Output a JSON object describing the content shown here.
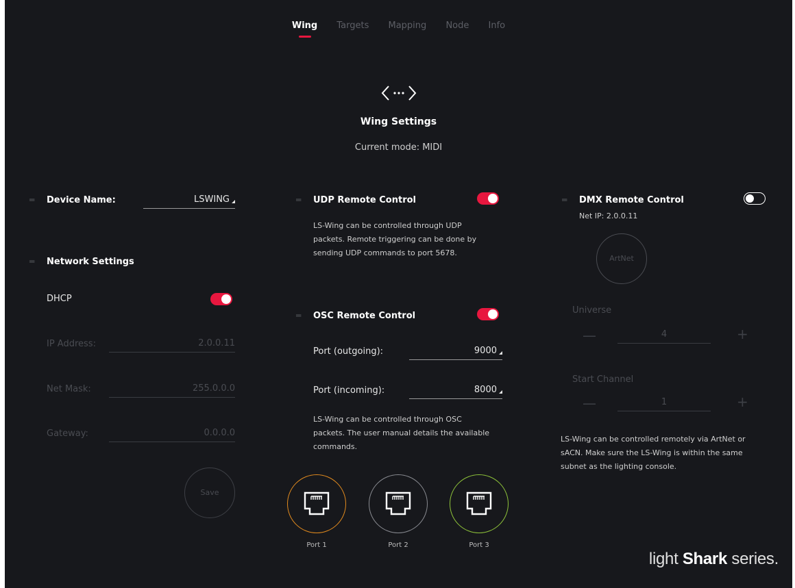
{
  "tabs": [
    "Wing",
    "Targets",
    "Mapping",
    "Node",
    "Info"
  ],
  "header": {
    "title": "Wing Settings",
    "mode": "Current mode: MIDI"
  },
  "device": {
    "label": "Device Name:",
    "value": "LSWING"
  },
  "network": {
    "title": "Network Settings",
    "dhcp_label": "DHCP",
    "dhcp_on": true,
    "ip_label": "IP Address:",
    "ip_value": "2.0.0.11",
    "mask_label": "Net Mask:",
    "mask_value": "255.0.0.0",
    "gateway_label": "Gateway:",
    "gateway_value": "0.0.0.0",
    "save_label": "Save"
  },
  "udp": {
    "title": "UDP Remote Control",
    "enabled": true,
    "desc": [
      "LS-Wing can be controlled through UDP",
      "packets. Remote triggering can be done by",
      "sending UDP commands to port 5678."
    ]
  },
  "osc": {
    "title": "OSC Remote Control",
    "enabled": true,
    "out_label": "Port (outgoing):",
    "out_value": "9000",
    "in_label": "Port (incoming):",
    "in_value": "8000",
    "desc": [
      "LS-Wing can be controlled through OSC",
      "packets. The user manual details the available",
      "commands."
    ]
  },
  "ports": [
    {
      "label": "Port 1",
      "color": "#e38b1e"
    },
    {
      "label": "Port 2",
      "color": "#8a8c92"
    },
    {
      "label": "Port 3",
      "color": "#8fc43a"
    }
  ],
  "dmx": {
    "title": "DMX Remote Control",
    "enabled": false,
    "net_ip": "Net IP: 2.0.0.11",
    "protocol_button": "ArtNet",
    "universe_label": "Universe",
    "universe_value": "4",
    "start_label": "Start Channel",
    "start_value": "1",
    "minus": "—",
    "plus": "+",
    "desc": [
      "LS-Wing can be controlled remotely via ArtNet or",
      "sACN. Make sure the LS-Wing is within the same",
      "subnet as the lighting console."
    ]
  },
  "brand": {
    "light": "light ",
    "shark": "Shark",
    "series": " series."
  },
  "colors": {
    "accent": "#e8173f",
    "background": "#17181c"
  }
}
